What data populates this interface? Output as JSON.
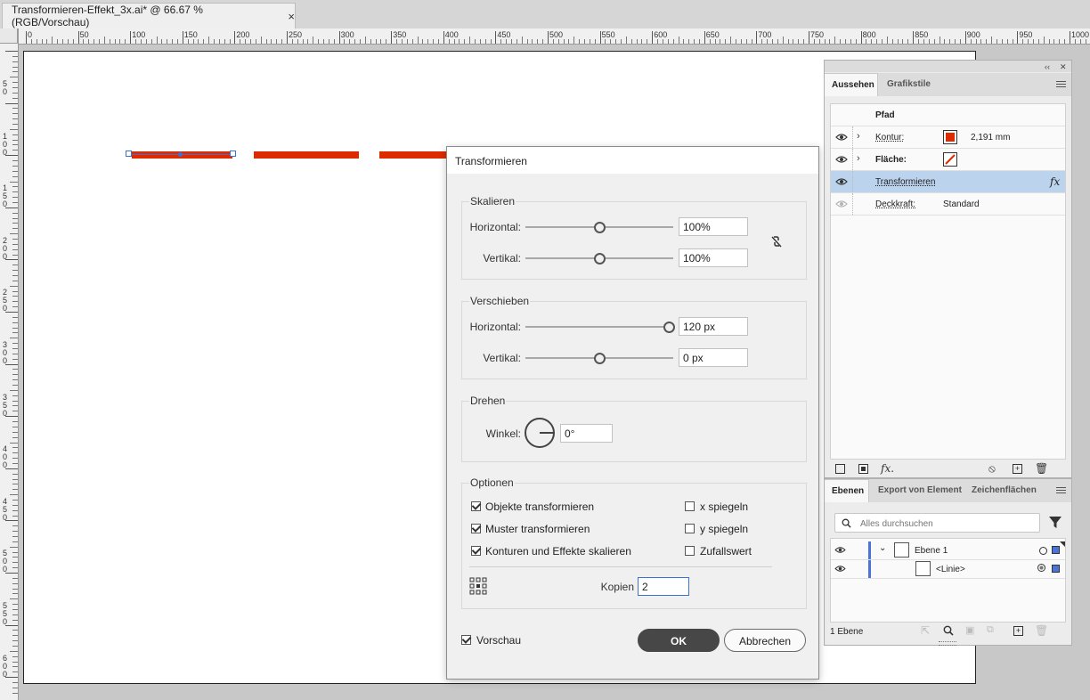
{
  "document_tab": {
    "title": "Transformieren-Effekt_3x.ai* @ 66.67 % (RGB/Vorschau)",
    "close": "×"
  },
  "ruler": {
    "h_labels": [
      "0",
      "50",
      "100",
      "150",
      "200",
      "250",
      "300",
      "350",
      "400",
      "450",
      "500",
      "550",
      "600",
      "650",
      "700",
      "750",
      "800",
      "850",
      "900",
      "950",
      "1000"
    ],
    "v_labels": [
      "5\n0",
      "1\n0\n0",
      "1\n5\n0",
      "2\n0\n0",
      "2\n5\n0",
      "3\n0\n0",
      "3\n5\n0",
      "4\n0\n0",
      "4\n5\n0",
      "5\n0\n0",
      "5\n5\n0",
      "6\n0\n0"
    ]
  },
  "colors": {
    "red_line": "#dd2a00",
    "selection": "#3b6fd9",
    "ok_bg": "#474747",
    "highlight_row": "#bcd3ed"
  },
  "appearance_panel": {
    "tabs": [
      "Aussehen",
      "Grafikstile"
    ],
    "collapse_icon": "‹‹",
    "object_type": "Pfad",
    "rows": [
      {
        "label": "Kontur:",
        "value": "2,191 mm"
      },
      {
        "label": "Fläche:"
      },
      {
        "label": "Transformieren",
        "fx": "fx"
      },
      {
        "label": "Deckkraft:",
        "value": "Standard"
      }
    ],
    "footer_fx": "fx."
  },
  "layers_panel": {
    "tabs": [
      "Ebenen",
      "Export von Element",
      "Zeichenflächen"
    ],
    "search_placeholder": "Alles durchsuchen",
    "layers": [
      {
        "name": "Ebene 1"
      },
      {
        "name": "<Linie>"
      }
    ],
    "count": "1 Ebene"
  },
  "dialog": {
    "title": "Transformieren",
    "scale": {
      "label": "Skalieren",
      "horizontal_label": "Horizontal:",
      "horizontal_value": "100%",
      "horizontal_slider": 0.5,
      "vertical_label": "Vertikal:",
      "vertical_value": "100%",
      "vertical_slider": 0.5
    },
    "move": {
      "label": "Verschieben",
      "horizontal_label": "Horizontal:",
      "horizontal_value": "120 px",
      "horizontal_slider": 0.97,
      "vertical_label": "Vertikal:",
      "vertical_value": "0 px",
      "vertical_slider": 0.5
    },
    "rotate": {
      "label": "Drehen",
      "angle_label": "Winkel:",
      "angle_value": "0°"
    },
    "options": {
      "label": "Optionen",
      "transform_objects": {
        "label": "Objekte transformieren",
        "checked": true
      },
      "transform_patterns": {
        "label": "Muster transformieren",
        "checked": true
      },
      "scale_strokes": {
        "label": "Konturen und Effekte skalieren",
        "checked": true
      },
      "reflect_x": {
        "label": "x spiegeln",
        "checked": false
      },
      "reflect_y": {
        "label": "y spiegeln",
        "checked": false
      },
      "random": {
        "label": "Zufallswert",
        "checked": false
      },
      "copies_label": "Kopien",
      "copies_value": "2"
    },
    "preview": {
      "label": "Vorschau",
      "checked": true
    },
    "ok_label": "OK",
    "cancel_label": "Abbrechen"
  }
}
